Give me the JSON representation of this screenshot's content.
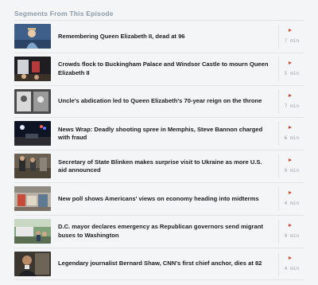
{
  "section_title": "Segments From This Episode",
  "colors": {
    "accent": "#d8482e",
    "header_text": "#8a9ba8",
    "divider": "#e2e5e8"
  },
  "segments": [
    {
      "title": "Remembering Queen Elizabeth II, dead at 96",
      "duration": "7 min",
      "thumb": "queen-portrait"
    },
    {
      "title": "Crowds flock to Buckingham Palace and Windsor Castle to mourn Queen Elizabeth II",
      "duration": "5 min",
      "thumb": "palace-crowd"
    },
    {
      "title": "Uncle's abdication led to Queen Elizabeth's 70-year reign on the throne",
      "duration": "7 min",
      "thumb": "archival-photo"
    },
    {
      "title": "News Wrap: Deadly shooting spree in Memphis, Steve Bannon charged with fraud",
      "duration": "6 min",
      "thumb": "night-police-scene"
    },
    {
      "title": "Secretary of State Blinken makes surprise visit to Ukraine as more U.S. aid announced",
      "duration": "9 min",
      "thumb": "ukraine-visit"
    },
    {
      "title": "New poll shows Americans' views on economy heading into midterms",
      "duration": "4 min",
      "thumb": "grocery-shoppers"
    },
    {
      "title": "D.C. mayor declares emergency as Republican governors send migrant buses to Washington",
      "duration": "9 min",
      "thumb": "migrant-bus"
    },
    {
      "title": "Legendary journalist Bernard Shaw, CNN's first chief anchor, dies at 82",
      "duration": "4 min",
      "thumb": "anchor-portrait"
    }
  ]
}
